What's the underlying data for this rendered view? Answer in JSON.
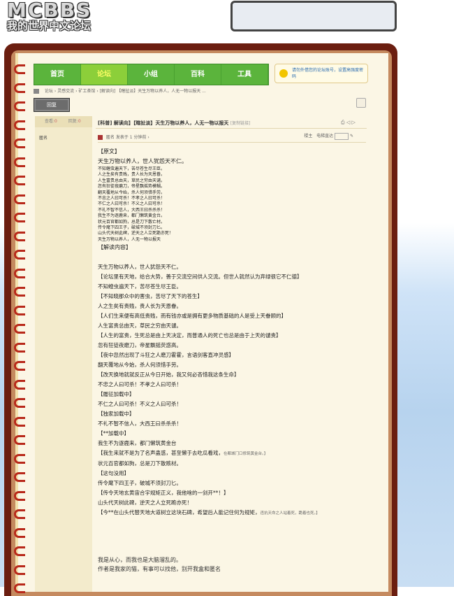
{
  "logo": {
    "big": "MCBBS",
    "small": "我的世界中文论坛"
  },
  "nav": {
    "tabs": [
      "首页",
      "论坛",
      "小组",
      "百科",
      "工具"
    ],
    "active": 1
  },
  "notice": {
    "text": "请勿外借您的论坛账号，设置高强度密码"
  },
  "breadcrumb": {
    "items": [
      "论坛",
      "灵感交流",
      "矿工茶馆",
      "[解读向] 【瞎扯淡】天生万物以养人，人无一物以报天 ..."
    ]
  },
  "reply_label": "回复",
  "stats": {
    "views_label": "查看:",
    "views": "0",
    "replies_label": "回复:",
    "replies": "0"
  },
  "author": "匿名",
  "post": {
    "title": "[科普] 解读向】【瞎扯淡】天生万物以养人，人无一物以报天",
    "copy": "[复制链接]",
    "meta_author": "匿名",
    "meta_time": "发表于 1 分钟前",
    "floor_label": "楼主",
    "jump_label": "电梯直达"
  },
  "content": {
    "orig_head": "【原文】",
    "orig_first": "天生万物以养人，世人犹怨天不仁。",
    "orig_lines": [
      "不知蝗虫遍天下，苦尽苍生尽王臣。",
      "人之生矣有贵贱，贵人长为天恩眷。",
      "人生富贵总由天，草民之穷由天谴。",
      "忽有狂徒夜磨刀，帝星飘摇势模糊。",
      "翻天覆地从今始，杀人何须惜手劳。",
      "不忠之人曰可杀！不孝之人曰可杀！",
      "不仁之人曰可杀！不义之人曰可杀！",
      "不礼不智不信人，大西王曰杀杀杀！",
      "我生不为逐鹿来，都门懒筑黄金台。",
      "状元百官都如狗，总是刀下散亡材。",
      "传令麾下四王子，破城不须封刀匕。",
      "山头代天树此碑，逆天之人立死跪亦死！",
      "天生万物以养人，人无一物以报天"
    ],
    "interp_head": "【解读内容】",
    "interp": [
      {
        "t": "天生万物以养人，世人犹怨天不仁。"
      },
      {
        "t": "【论坛里有天地，给合大势，善于交流空间供人交流。但世人就然认为弃绿很它不仁德】"
      },
      {
        "t": "不知蝗虫遍天下，苦尽苍生尽王臣。"
      },
      {
        "t": "【不知晓那众中的害虫，苦尽了天下的苍生】"
      },
      {
        "t": "人之生矣有贵贱，贵人长为天恩眷。"
      },
      {
        "t": "【人们生来便有高低贵贱，而有钱亦或是拥有更多物质基础的人是受上天眷顾的】"
      },
      {
        "t": "人生富贵总由天，草民之穷由天谴。"
      },
      {
        "t": "【人生的富贵，生死总是由上天决定，而普通人的死亡也总是由于上天的谴责】"
      },
      {
        "t": "忽有狂徒夜磨刀，帝星飘摇荧惑高。"
      },
      {
        "t": "【夜中忽然出现了斗狂之人磨刀霍霍，言语剑客直冲灵感】"
      },
      {
        "t": "翻天覆地从今始，杀人何须惜手劳。"
      },
      {
        "t": "【改天换地就就反正从今日开始，我又何必吝惜我这条生命】"
      },
      {
        "t": "不忠之人曰可杀！不孝之人曰可杀！"
      },
      {
        "t": "【履征加载中】"
      },
      {
        "t": "不仁之人曰可杀！不义之人曰可杀！"
      },
      {
        "t": "【独家加载中】"
      },
      {
        "t": "不礼不智不信人，大西王曰杀杀杀！"
      },
      {
        "t": "【**加载中】"
      },
      {
        "t": "我生不为逐鹿来，都门懒筑黄金台"
      },
      {
        "t": "【我生来就不是为了名声蛊惑，甚至懒于去吃瓜看戏，",
        "s": "在都城门口修筑黄金台。】"
      },
      {
        "t": "状元百官都如狗，总是刀下散赅材。"
      },
      {
        "t": "【这句没用】"
      },
      {
        "t": "传令麾下四王子，破城不须封刀匕。"
      },
      {
        "t": "【传令天地玄黄宙合宇规矩正义，我他啥的一剑开**！】"
      },
      {
        "t": "山头代天树此碑，逆天之人立死跪亦死！"
      },
      {
        "t": "【今**在山头代替天地大道树立这块石碑，希望后人能记住何为规矩，",
        "s": "违抗天命之人站着死，跪着也死。】"
      }
    ],
    "footer": [
      "我是从心，而我也是大脑溜乱的。",
      "作者是我家的猫，有事可以找他，别开我盒和匿名"
    ]
  },
  "colors": {
    "nav_green": "#5bb43c",
    "nav_active": "#8ccf3a",
    "frame": "#6b1e10",
    "page": "#fbf6e5"
  }
}
